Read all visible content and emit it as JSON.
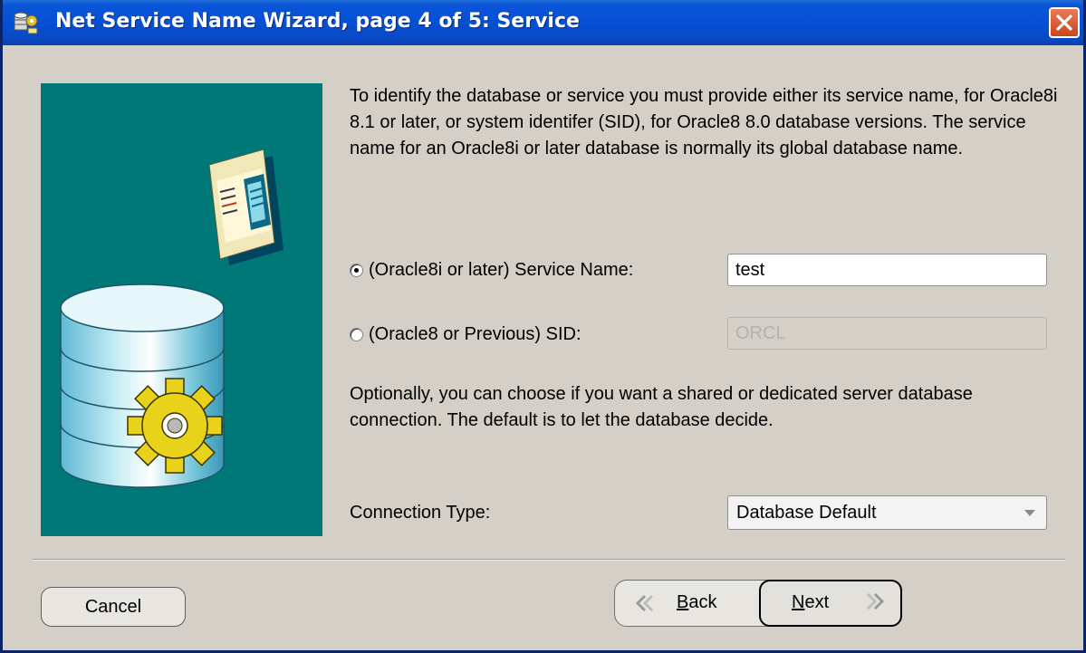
{
  "window": {
    "title": "Net Service Name Wizard, page 4 of 5: Service"
  },
  "intro_text": "To identify the database or service you must provide either its service name, for Oracle8i 8.1 or later, or system identifer (SID), for Oracle8 8.0 database versions. The service name for an Oracle8i or later database is normally its global database name.",
  "service_name_option": {
    "label": "(Oracle8i or later)  Service Name:",
    "selected": true,
    "value": "test"
  },
  "sid_option": {
    "label": "(Oracle8 or Previous) SID:",
    "selected": false,
    "value": "ORCL"
  },
  "optional_text": "Optionally, you can choose if you want a shared or dedicated server database connection. The default is to let the database decide.",
  "connection_type": {
    "label": "Connection Type:",
    "selected": "Database Default"
  },
  "buttons": {
    "cancel": "Cancel",
    "back_mnemonic": "B",
    "back_rest": "ack",
    "next_mnemonic": "N",
    "next_rest": "ext"
  },
  "colors": {
    "banner": "#007878",
    "titlebar": "#0550d4",
    "dialog": "#d4d0c8"
  },
  "icons": [
    "app-icon",
    "close-icon",
    "database-icon",
    "gear-icon",
    "document-icon",
    "back-chevron-icon",
    "next-chevron-icon",
    "dropdown-arrow-icon"
  ]
}
